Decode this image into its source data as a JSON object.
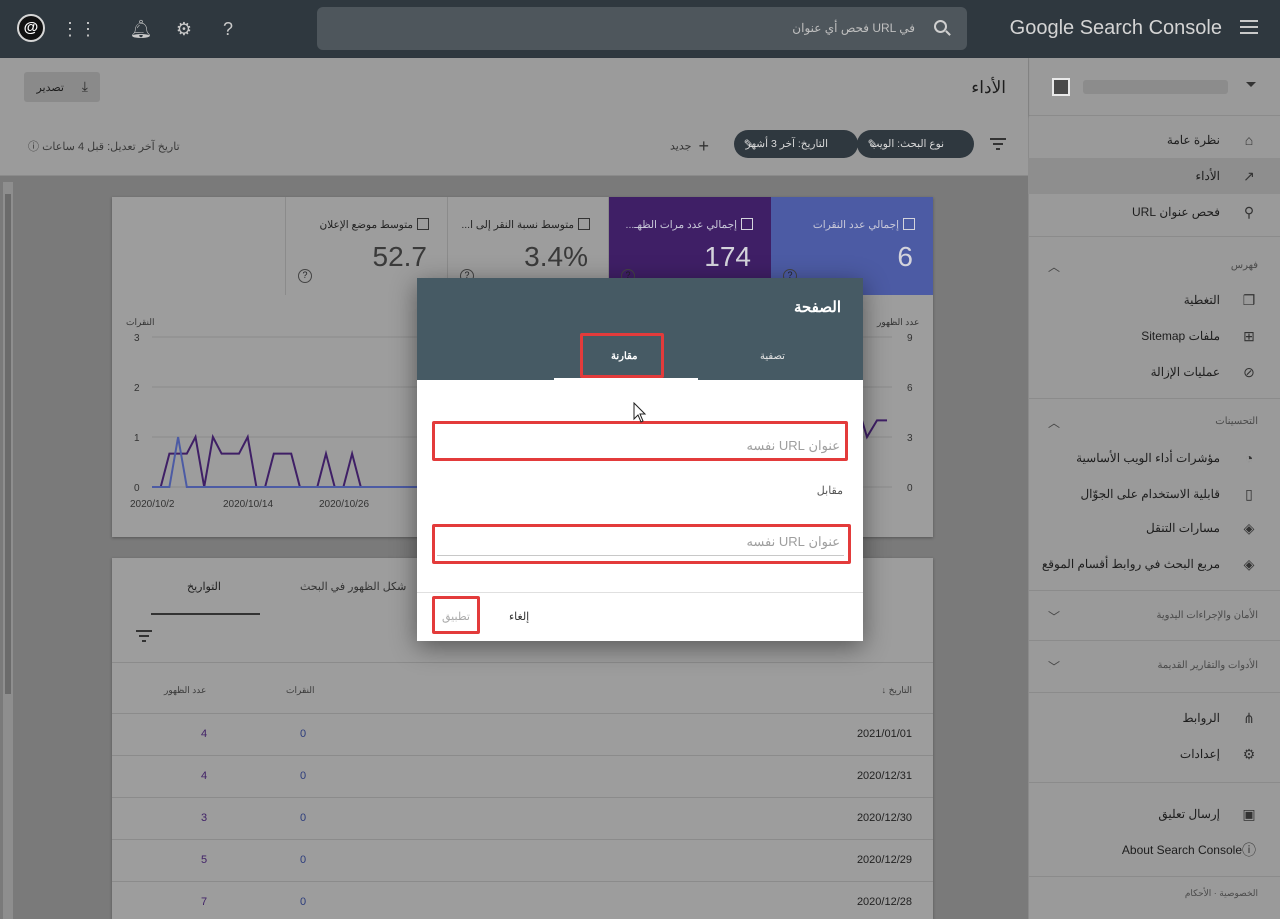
{
  "topbar": {
    "app_title": "Google Search Console",
    "search_placeholder": "فحص أي عنوان URL في"
  },
  "sidebar": {
    "items_top": [
      {
        "label": "نظرة عامة",
        "icon": "home-icon"
      },
      {
        "label": "الأداء",
        "icon": "trending-up-icon"
      },
      {
        "label": "فحص عنوان URL",
        "icon": "search-icon"
      }
    ],
    "section_index": "فهرس",
    "items_index": [
      {
        "label": "التغطية",
        "icon": "copy-icon"
      },
      {
        "label": "ملفات Sitemap",
        "icon": "sitemap-icon"
      },
      {
        "label": "عمليات الإزالة",
        "icon": "eye-off-icon"
      }
    ],
    "section_enhancements": "التحسينات",
    "items_enh": [
      {
        "label": "مؤشرات أداء الويب الأساسية",
        "icon": "gauge-icon"
      },
      {
        "label": "قابلية الاستخدام على الجوّال",
        "icon": "phone-icon"
      },
      {
        "label": "مسارات التنقل",
        "icon": "layers-icon"
      },
      {
        "label": "مربع البحث في روابط أقسام الموقع",
        "icon": "layers-icon"
      }
    ],
    "section_security": "الأمان والإجراءات اليدوية",
    "section_legacy": "الأدوات والتقارير القديمة",
    "items_bottom": [
      {
        "label": "الروابط",
        "icon": "network-icon"
      },
      {
        "label": "إعدادات",
        "icon": "gear-icon"
      }
    ],
    "feedback": "إرسال تعليق",
    "about": "About Search Console",
    "footer": "الخصوصية · الأحكام"
  },
  "page": {
    "title": "الأداء",
    "export_label": "تصدير",
    "chip_search_type": "نوع البحث: الويب",
    "chip_date": "التاريخ: آخر 3 أشهر",
    "new_label": "جديد",
    "last_updated": "تاريخ آخر تعديل: قبل 4 ساعات"
  },
  "metrics": [
    {
      "key": "clicks",
      "label": "إجمالي عدد النقرات",
      "value": "6",
      "checked": true,
      "color": "#4c5ba4"
    },
    {
      "key": "impressions",
      "label": "إجمالي عدد مرات الظهـ...",
      "value": "174",
      "checked": true,
      "color": "#3f1f66"
    },
    {
      "key": "ctr",
      "label": "متوسط نسبة النقر إلى ا...",
      "value": "3.4%",
      "checked": false
    },
    {
      "key": "position",
      "label": "متوسط موضع الإعلان",
      "value": "52.7",
      "checked": false
    }
  ],
  "chart_data": {
    "type": "line",
    "left_axis_title": "النقرات",
    "right_axis_title": "عدد الظهور",
    "left_ticks": [
      "3",
      "2",
      "1",
      "0"
    ],
    "right_ticks": [
      "9",
      "6",
      "3",
      "0"
    ],
    "x_ticks": [
      "2020/10/2",
      "2020/10/14",
      "2020/10/26"
    ],
    "ylim_left": [
      0,
      3
    ],
    "ylim_right": [
      0,
      9
    ],
    "series": [
      {
        "color": "#2c2c8c",
        "values": [
          0,
          0,
          0,
          1,
          0,
          0,
          0,
          0,
          0,
          0,
          0,
          0,
          0,
          0,
          0,
          0,
          0,
          0,
          0,
          0,
          0,
          0,
          0,
          0,
          0,
          0,
          0,
          0,
          0,
          0,
          0,
          0,
          0,
          0,
          0,
          0
        ]
      },
      {
        "color": "#3f1f66",
        "values": [
          0,
          0,
          2,
          2,
          2,
          3,
          0,
          3,
          2,
          2,
          2,
          3,
          0,
          0,
          2,
          2,
          2,
          0,
          0,
          0,
          2,
          0,
          0,
          2,
          0,
          0,
          0,
          0,
          0,
          0,
          0,
          0,
          0,
          0,
          0,
          0
        ]
      },
      {
        "color": "#3f1f66",
        "values": [
          5,
          3,
          4,
          4
        ]
      }
    ]
  },
  "table": {
    "tabs": [
      "التواريخ",
      "شكل الظهور في البحث"
    ],
    "col_date": "التاريخ",
    "col_clicks": "النقرات",
    "col_impressions": "عدد الظهور",
    "rows": [
      {
        "date": "2021/01/01",
        "clicks": "0",
        "impressions": "4"
      },
      {
        "date": "2020/12/31",
        "clicks": "0",
        "impressions": "4"
      },
      {
        "date": "2020/12/30",
        "clicks": "0",
        "impressions": "3"
      },
      {
        "date": "2020/12/29",
        "clicks": "0",
        "impressions": "5"
      },
      {
        "date": "2020/12/28",
        "clicks": "0",
        "impressions": "7"
      }
    ]
  },
  "dialog": {
    "title": "الصفحة",
    "tab_filter": "تصفية",
    "tab_compare": "مقارنة",
    "field1_placeholder": "عنوان URL نفسه",
    "vs_label": "مقابل",
    "field2_placeholder": "عنوان URL نفسه",
    "cancel_label": "إلغاء",
    "apply_label": "تطبيق"
  },
  "colors": {
    "highlight": "#e33b3b",
    "dialog_header": "#465a64",
    "topbar": "#2f383f"
  }
}
